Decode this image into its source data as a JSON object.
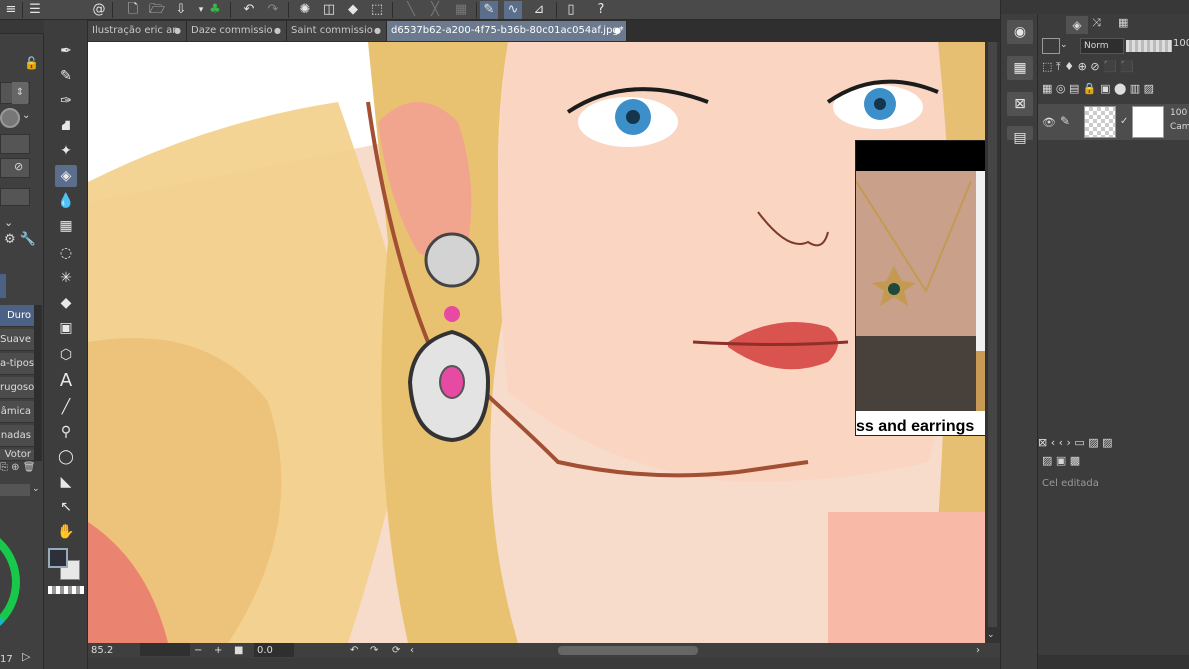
{
  "tabs": [
    {
      "label": "Ilustração eric ar",
      "active": false
    },
    {
      "label": "Daze commissio",
      "active": false
    },
    {
      "label": "Saint commissio",
      "active": false
    },
    {
      "label": "d6537b62-a200-4f75-b36b-80c01ac054af.jpg*",
      "active": true
    }
  ],
  "tab_close_glyph": "●",
  "subtools": [
    "Duro",
    "Suave",
    "a-tipos",
    "rugoso",
    "âmica",
    "nadas",
    "Votor"
  ],
  "active_subtool": "Duro",
  "status": {
    "zoom": "85.2",
    "rotation": "0.0",
    "bottom_left_number": "17"
  },
  "layer_panel": {
    "blend_mode": "Norm",
    "opacity": "100",
    "layer1_opacity": "100",
    "layer1_mode": "Cam",
    "status_text": "Cel editada"
  },
  "reference": {
    "caption": "ss and earrings"
  },
  "colors": {
    "accent": "#4b6286",
    "canvas_skin": "#f6d6c0",
    "hair": "#e8c77a",
    "gem_pink": "#e64aa3",
    "wheel_green": "#18c84a"
  },
  "icons": {
    "top": [
      "spiral-icon",
      "new-file-icon",
      "open-icon",
      "save-icon",
      "grass-icon",
      "undo-icon",
      "redo-icon",
      "spinner-icon",
      "fill-icon",
      "transform-icon",
      "vector-icon",
      "curve-icon",
      "ruler-icon",
      "phone-icon",
      "help-icon"
    ],
    "tools": [
      "pen-icon",
      "pencil-icon",
      "ink-icon",
      "airbrush-icon",
      "sparkle-icon",
      "eraser-icon",
      "blend-icon",
      "mesh-icon",
      "lasso-icon",
      "magic-wand-icon",
      "bucket-icon",
      "gradient-icon",
      "3d-icon",
      "text-icon",
      "line-icon",
      "eyedropper-icon",
      "ellipse-icon",
      "figure-icon",
      "connector-icon",
      "hand-icon"
    ],
    "right_strip": [
      "navigator-icon",
      "grid-icon",
      "close-panel-icon",
      "layers-icon"
    ]
  }
}
